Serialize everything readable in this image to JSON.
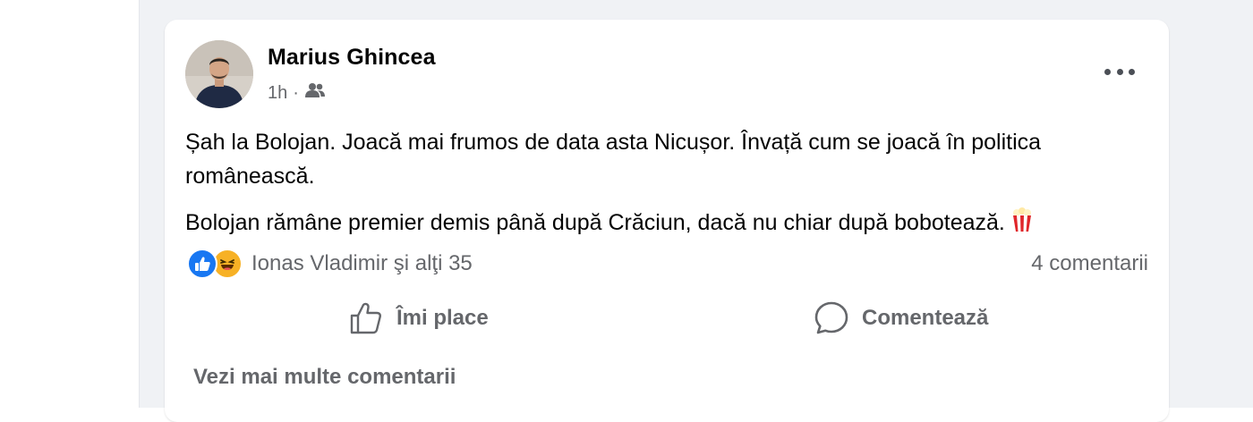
{
  "post": {
    "author": "Marius Ghincea",
    "time": "1h",
    "separator": "·",
    "audience_icon": "friends-icon",
    "paragraphs": [
      "Șah la Bolojan. Joacă mai frumos de data asta Nicușor. Învață cum se joacă în politica românească.",
      "Bolojan rămâne premier demis până după Crăciun, dacă nu chiar după bobotează."
    ],
    "emoji_icon": "popcorn-icon"
  },
  "reactions": {
    "icons": [
      "like-reaction-icon",
      "haha-reaction-icon"
    ],
    "names": "Ionas Vladimir şi alţi 35",
    "comments_count": "4 comentarii"
  },
  "actions": {
    "like_label": "Îmi place",
    "comment_label": "Comentează"
  },
  "see_more_comments": "Vezi mai multe comentarii",
  "colors": {
    "feed_background": "#f0f2f5",
    "card_background": "#ffffff",
    "secondary_text": "#65676b",
    "like_blue": "#1877f2",
    "haha_yellow": "#f7b125"
  }
}
